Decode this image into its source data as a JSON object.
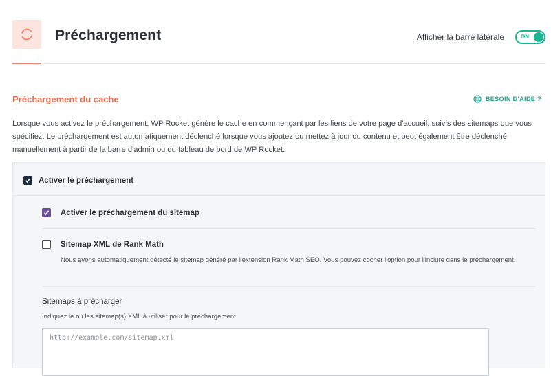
{
  "header": {
    "title": "Préchargement",
    "icon": "refresh-icon",
    "sidebar_label": "Afficher la barre latérale",
    "toggle_state": "ON",
    "accent_color": "#f5846b",
    "toggle_color": "#19b592"
  },
  "section": {
    "title": "Préchargement du cache",
    "help_label": "BESOIN D'AIDE ?",
    "help_icon": "lifebuoy-icon",
    "description": {
      "before_link": "Lorsque vous activez le préchargement, WP Rocket génère le cache en commençant par les liens de votre page d'accueil, suivis des sitemaps que vous spécifiez. Le préchargement est automatiquement déclenché lorsque vous ajoutez ou mettez à jour du contenu et peut également être déclenché manuellement à partir de la barre d'admin ou du ",
      "link": "tableau de bord de WP Rocket",
      "after_link": "."
    }
  },
  "options": {
    "enable_preload": {
      "label": "Activer le préchargement",
      "checked": true
    },
    "enable_sitemap": {
      "label": "Activer le préchargement du sitemap",
      "checked": true
    },
    "rank_math": {
      "label": "Sitemap XML de Rank Math",
      "checked": false,
      "help": "Nous avons automatiquement détecté le sitemap généré par l'extension Rank Math SEO. Vous pouvez cocher l'option pour l'inclure dans le préchargement."
    },
    "sitemaps": {
      "title": "Sitemaps à précharger",
      "description": "Indiquez le ou les sitemap(s) XML à utiliser pour le préchargement",
      "placeholder": "http://example.com/sitemap.xml"
    }
  }
}
